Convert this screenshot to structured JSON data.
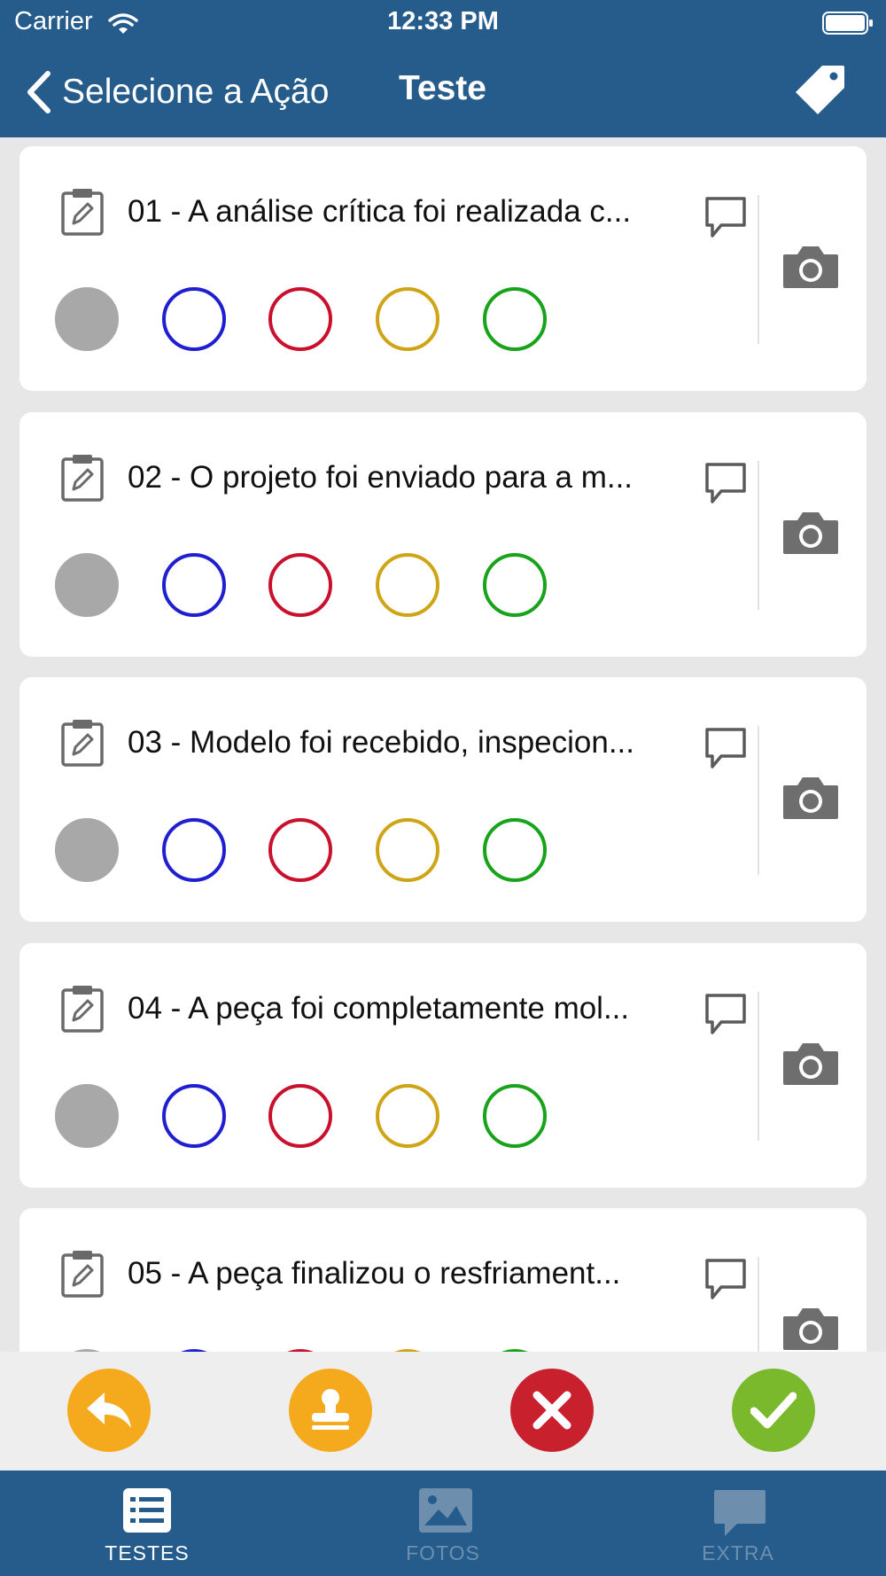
{
  "status_bar": {
    "carrier": "Carrier",
    "time": "12:33 PM"
  },
  "nav": {
    "back_label": "Selecione a Ação",
    "title": "Teste"
  },
  "options": [
    {
      "color": "#a8a8a8",
      "selected": true
    },
    {
      "color": "#1f1fd1"
    },
    {
      "color": "#c9102c"
    },
    {
      "color": "#cfa416"
    },
    {
      "color": "#18a31a"
    }
  ],
  "items": [
    {
      "title": "01 - A análise crítica foi realizada c..."
    },
    {
      "title": "02 - O projeto foi enviado para a m..."
    },
    {
      "title": "03 - Modelo foi recebido, inspecion..."
    },
    {
      "title": "04 - A peça foi completamente mol..."
    },
    {
      "title": "05 - A peça finalizou o resfriament..."
    }
  ],
  "actions": [
    {
      "name": "undo",
      "color": "#f5a91c"
    },
    {
      "name": "stamp",
      "color": "#f5a91c"
    },
    {
      "name": "reject",
      "color": "#c9202e"
    },
    {
      "name": "approve",
      "color": "#7ab82c"
    }
  ],
  "tabs": [
    {
      "label": "TESTES",
      "active": true
    },
    {
      "label": "FOTOS",
      "active": false
    },
    {
      "label": "EXTRA",
      "active": false
    }
  ],
  "colors": {
    "primary": "#255c8b",
    "background": "#e7e7e7",
    "tab_active": "#ffffff",
    "tab_inactive": "#6d8fad"
  }
}
